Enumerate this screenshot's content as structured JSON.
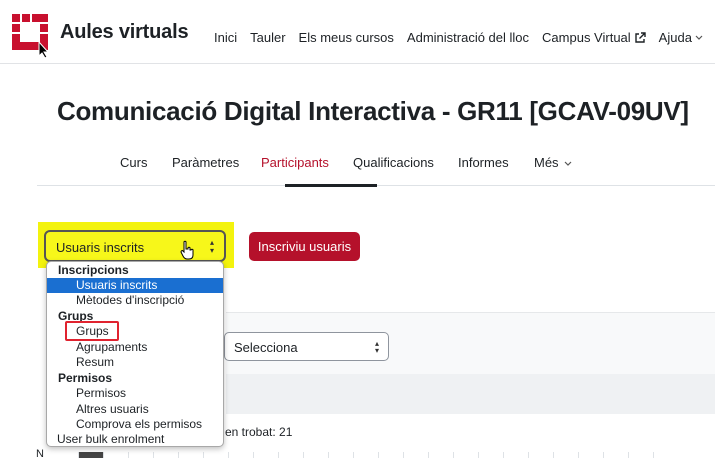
{
  "navbar": {
    "site_name": "Aules virtuals",
    "items": [
      {
        "label": "Inici"
      },
      {
        "label": "Tauler"
      },
      {
        "label": "Els meus cursos"
      },
      {
        "label": "Administració del lloc"
      },
      {
        "label": "Campus Virtual",
        "icon": "external-link-icon"
      },
      {
        "label": "Ajuda",
        "icon": "chevron-down-icon"
      }
    ],
    "brand_color": "#c8102e"
  },
  "course": {
    "title": "Comunicació Digital Interactiva - GR11 [GCAV-09UV]"
  },
  "tabs": {
    "items": [
      {
        "label": "Curs"
      },
      {
        "label": "Paràmetres"
      },
      {
        "label": "Participants",
        "active": true
      },
      {
        "label": "Qualificacions"
      },
      {
        "label": "Informes"
      },
      {
        "label": "Més",
        "icon": "chevron-down-icon"
      }
    ]
  },
  "enrolment_select": {
    "value": "Usuaris inscrits",
    "highlight_color": "#f3f30e"
  },
  "enrol_button": {
    "label": "Inscriviu usuaris",
    "color": "#b5112b"
  },
  "dropdown": {
    "groups": [
      {
        "label": "Inscripcions",
        "options": [
          "Usuaris inscrits",
          "Mètodes d'inscripció"
        ]
      },
      {
        "label": "Grups",
        "options": [
          "Grups",
          "Agrupaments",
          "Resum"
        ]
      },
      {
        "label": "Permisos",
        "options": [
          "Permisos",
          "Altres usuaris",
          "Comprova els permisos"
        ]
      }
    ],
    "selected": "Usuaris inscrits",
    "outlined": "Grups",
    "extra_option": "User bulk enrolment",
    "selected_color": "#1a6fd1"
  },
  "filter": {
    "value": "Selecciona"
  },
  "results": {
    "found_text": "en trobat: 21"
  },
  "name_filter": {
    "label": "N"
  }
}
